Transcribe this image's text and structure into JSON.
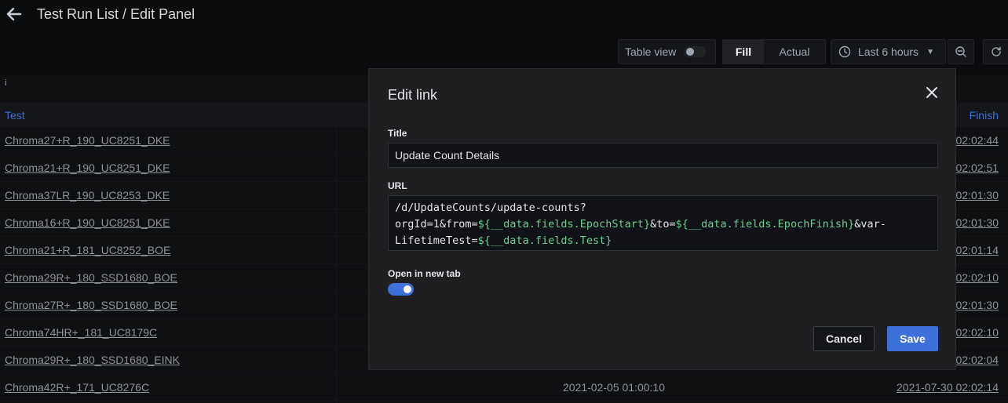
{
  "header": {
    "title": "Test Run List / Edit Panel"
  },
  "toolbar": {
    "table_view_label": "Table view",
    "fill_label": "Fill",
    "actual_label": "Actual",
    "time_range_label": "Last 6 hours"
  },
  "panel": {
    "info_icon": "info-icon",
    "columns": {
      "test": "Test",
      "finish": "Finish"
    },
    "rows": [
      {
        "test": "Chroma27+R_190_UC8251_DKE",
        "finish": "02:02:44"
      },
      {
        "test": "Chroma21+R_190_UC8251_DKE",
        "finish": "02:02:51"
      },
      {
        "test": "Chroma37LR_190_UC8253_DKE",
        "finish": "02:01:30"
      },
      {
        "test": "Chroma16+R_190_UC8251_DKE",
        "finish": "02:01:30"
      },
      {
        "test": "Chroma21+R_181_UC8252_BOE",
        "finish": "02:01:14"
      },
      {
        "test": "Chroma29R+_180_SSD1680_BOE",
        "finish": "02:02:10"
      },
      {
        "test": "Chroma27R+_180_SSD1680_BOE",
        "finish": "02:01:30"
      },
      {
        "test": "Chroma74HR+_181_UC8179C",
        "finish": "02:02:10"
      },
      {
        "test": "Chroma29R+_180_SSD1680_EINK",
        "finish": "02:02:04"
      },
      {
        "test": "Chroma42R+_171_UC8276C",
        "mid": "2021-02-05 01:00:10",
        "finish": "2021-07-30 02:02:14"
      }
    ]
  },
  "modal": {
    "title": "Edit link",
    "title_label": "Title",
    "title_value": "Update Count Details",
    "url_label": "URL",
    "url_parts": {
      "p1": "/d/UpdateCounts/update-counts?",
      "p2": "orgId=1&from=",
      "p3": "${__data.fields.EpochStart}",
      "p4": "&to=",
      "p5": "${__data.fields.EpochFinish}",
      "p6": "&var-",
      "p7": "LifetimeTest=",
      "p8": "${__data.fields.Test}"
    },
    "new_tab_label": "Open in new tab",
    "new_tab_enabled": true,
    "cancel_label": "Cancel",
    "save_label": "Save"
  },
  "colors": {
    "accent": "#3d71d9",
    "variable": "#6ccf8e",
    "background": "#0b0c0e",
    "modal_bg": "#1f1f22"
  }
}
